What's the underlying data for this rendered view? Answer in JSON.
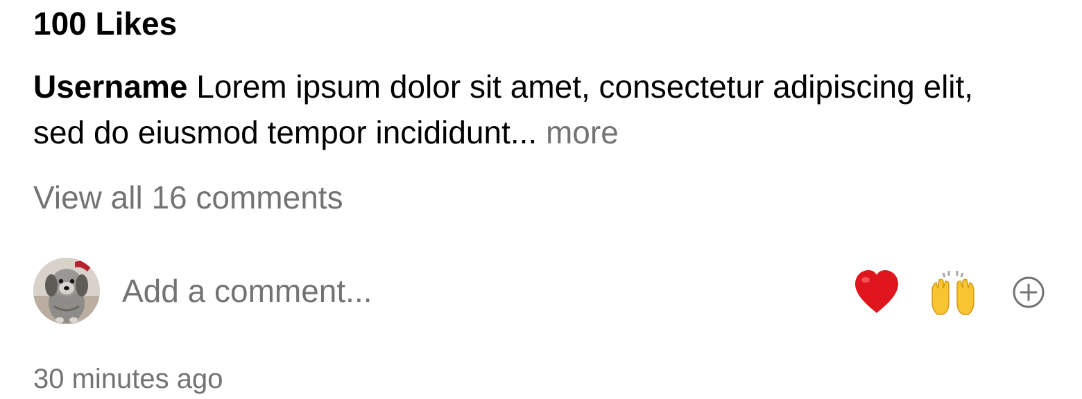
{
  "post": {
    "likes": "100 Likes",
    "caption": {
      "username": "Username",
      "text": "Lorem ipsum dolor sit amet, consectetur adipiscing elit, sed do eiusmod tempor incididunt...",
      "more_label": "more"
    },
    "view_comments_label": "View all 16 comments",
    "comment_box": {
      "placeholder": "Add a comment...",
      "avatar_icon": "dog-avatar",
      "quick_reactions": [
        {
          "icon": "red-heart-emoji",
          "char": "❤️"
        },
        {
          "icon": "raising-hands-emoji",
          "char": "🙌"
        }
      ],
      "add_icon": "plus-circle-icon"
    },
    "timestamp": "30 minutes ago"
  },
  "colors": {
    "text": "#000000",
    "secondary_text": "#737373",
    "background": "#ffffff",
    "heart": "#e0161e",
    "hands": "#f7c531"
  }
}
